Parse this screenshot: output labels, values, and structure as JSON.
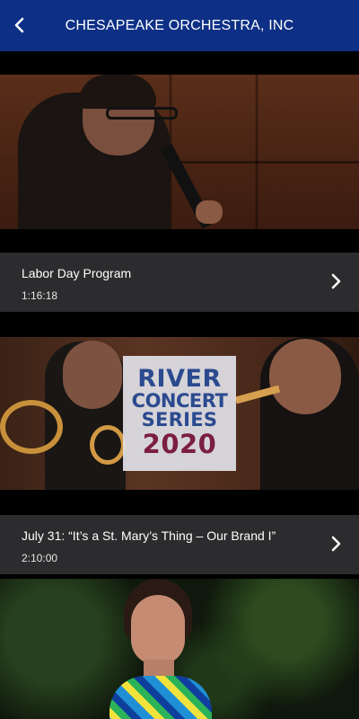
{
  "header": {
    "title": "CHESAPEAKE ORCHESTRA, INC",
    "back_icon": "back-arrow-icon",
    "background": "#0d2f85"
  },
  "videos": [
    {
      "title": "Labor Day Program",
      "duration": "1:16:18",
      "chevron_icon": "chevron-right-icon"
    },
    {
      "title": "July 31: “It’s a St. Mary’s Thing – Our Brand I”",
      "duration": "2:10:00",
      "chevron_icon": "chevron-right-icon",
      "thumbnail_logo": {
        "line1": "RIVER",
        "line2": "CONCERT",
        "line3": "SERIES",
        "line4": "2020"
      }
    },
    {
      "title": "",
      "duration": ""
    }
  ],
  "colors": {
    "info_bar": "#2c2c2e",
    "logo_blue": "#2b4a8f",
    "logo_maroon": "#7b1e42"
  }
}
